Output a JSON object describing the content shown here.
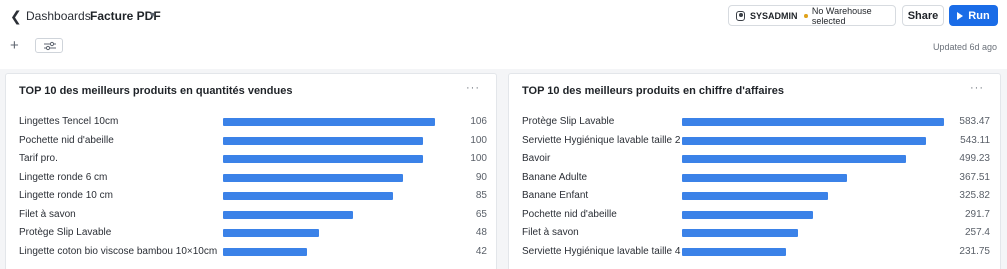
{
  "header": {
    "breadcrumb": "Dashboards",
    "title": "Facture PDF",
    "role": "SYSADMIN",
    "warehouse": "No Warehouse selected",
    "share_label": "Share",
    "run_label": "Run",
    "updated": "Updated 6d ago",
    "status_dot_color": "#e0a21b",
    "accent_color": "#1a6ce7"
  },
  "cards": [
    {
      "title": "TOP 10 des meilleurs produits en quantités vendues",
      "chart_data": {
        "type": "bar",
        "orientation": "horizontal",
        "categories": [
          "Lingettes Tencel 10cm",
          "Pochette nid d'abeille",
          "Tarif pro.",
          "Lingette ronde 6 cm",
          "Lingette ronde 10 cm",
          "Filet à savon",
          "Protège Slip Lavable",
          "Lingette coton bio viscose bambou 10×10cm"
        ],
        "values": [
          106,
          100,
          100,
          90,
          85,
          65,
          48,
          42
        ],
        "labels": [
          "106",
          "100",
          "100",
          "90",
          "85",
          "65",
          "48",
          "42"
        ],
        "bar_color": "#3b82e8"
      }
    },
    {
      "title": "TOP 10 des meilleurs produits en chiffre d'affaires",
      "chart_data": {
        "type": "bar",
        "orientation": "horizontal",
        "categories": [
          "Protège Slip Lavable",
          "Serviette Hygiénique lavable taille 2",
          "Bavoir",
          "Banane Adulte",
          "Banane Enfant",
          "Pochette nid d'abeille",
          "Filet à savon",
          "Serviette Hygiénique lavable taille 4"
        ],
        "values": [
          583.47,
          543.11,
          499.23,
          367.51,
          325.82,
          291.7,
          257.4,
          231.75
        ],
        "labels": [
          "583.47",
          "543.11",
          "499.23",
          "367.51",
          "325.82",
          "291.7",
          "257.4",
          "231.75"
        ],
        "bar_color": "#3b82e8"
      }
    }
  ]
}
